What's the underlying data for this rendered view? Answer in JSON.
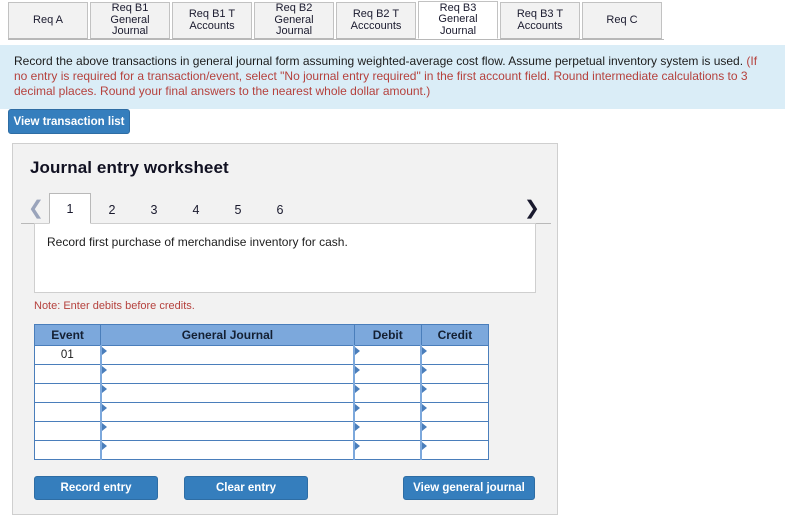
{
  "req_tabs": [
    {
      "label": "Req A",
      "active": false
    },
    {
      "label": "Req B1\nGeneral\nJournal",
      "active": false
    },
    {
      "label": "Req B1 T\nAccounts",
      "active": false
    },
    {
      "label": "Req B2\nGeneral\nJournal",
      "active": false
    },
    {
      "label": "Req B2 T\nAcccounts",
      "active": false
    },
    {
      "label": "Req B3\nGeneral\nJournal",
      "active": true
    },
    {
      "label": "Req B3 T\nAccounts",
      "active": false
    },
    {
      "label": "Req C",
      "active": false
    }
  ],
  "instructions": {
    "lead": "Record the above transactions in general journal form assuming weighted-average cost flow. Assume perpetual inventory system is used. ",
    "red": "(If no entry is required for a transaction/event, select \"No journal entry required\" in the first account field. Round intermediate calculations to 3 decimal places. Round your final answers to the nearest whole dollar amount.)"
  },
  "toolbar": {
    "view_transaction_list_label": "View transaction list"
  },
  "worksheet": {
    "title": "Journal entry worksheet",
    "pager": {
      "prev_icon": "chevron-left-icon",
      "next_icon": "chevron-right-icon",
      "pages": [
        "1",
        "2",
        "3",
        "4",
        "5",
        "6"
      ],
      "active_page": "1"
    },
    "transaction_text": "Record first purchase of merchandise inventory for cash.",
    "hint": "Note: Enter debits before credits.",
    "table": {
      "headers": [
        "Event",
        "General Journal",
        "Debit",
        "Credit"
      ],
      "rows": [
        {
          "event": "01",
          "general_journal": "",
          "debit": "",
          "credit": ""
        },
        {
          "event": "",
          "general_journal": "",
          "debit": "",
          "credit": ""
        },
        {
          "event": "",
          "general_journal": "",
          "debit": "",
          "credit": ""
        },
        {
          "event": "",
          "general_journal": "",
          "debit": "",
          "credit": ""
        },
        {
          "event": "",
          "general_journal": "",
          "debit": "",
          "credit": ""
        },
        {
          "event": "",
          "general_journal": "",
          "debit": "",
          "credit": ""
        }
      ]
    },
    "buttons": {
      "record_entry": "Record entry",
      "clear_entry": "Clear entry",
      "view_general_journal": "View general journal"
    }
  },
  "colors": {
    "accent_blue": "#357ebd",
    "table_header_blue": "#7ca8dc",
    "table_border_blue": "#4a7ebb",
    "banner_blue": "#daedf7",
    "red_text": "#b5413d",
    "panel_gray": "#f2f2f2"
  }
}
